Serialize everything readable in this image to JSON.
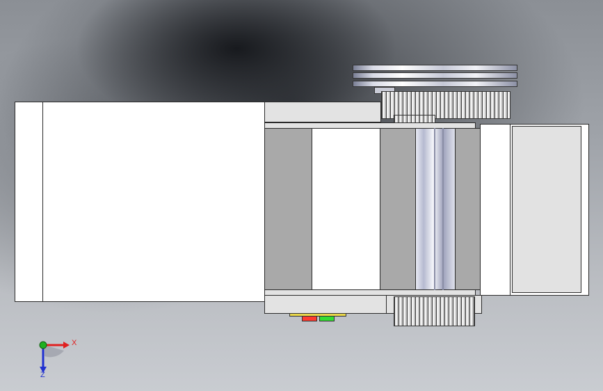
{
  "viewport": {
    "background_top": "#8b8f95",
    "background_bottom": "#c9ccd1",
    "shadow_color": "#1a1c20"
  },
  "model": {
    "edge_color": "#2a2a2a",
    "face_white": "#ffffff",
    "face_light": "#e3e3e3",
    "face_mid": "#a9a9a9",
    "led_colors": [
      "#ff3b30",
      "#33dd33",
      "#e8d64a"
    ]
  },
  "triad": {
    "x_label": "X",
    "z_label": "Z",
    "x_color": "#e02020",
    "y_color": "#20b020",
    "z_color": "#2030d0"
  }
}
